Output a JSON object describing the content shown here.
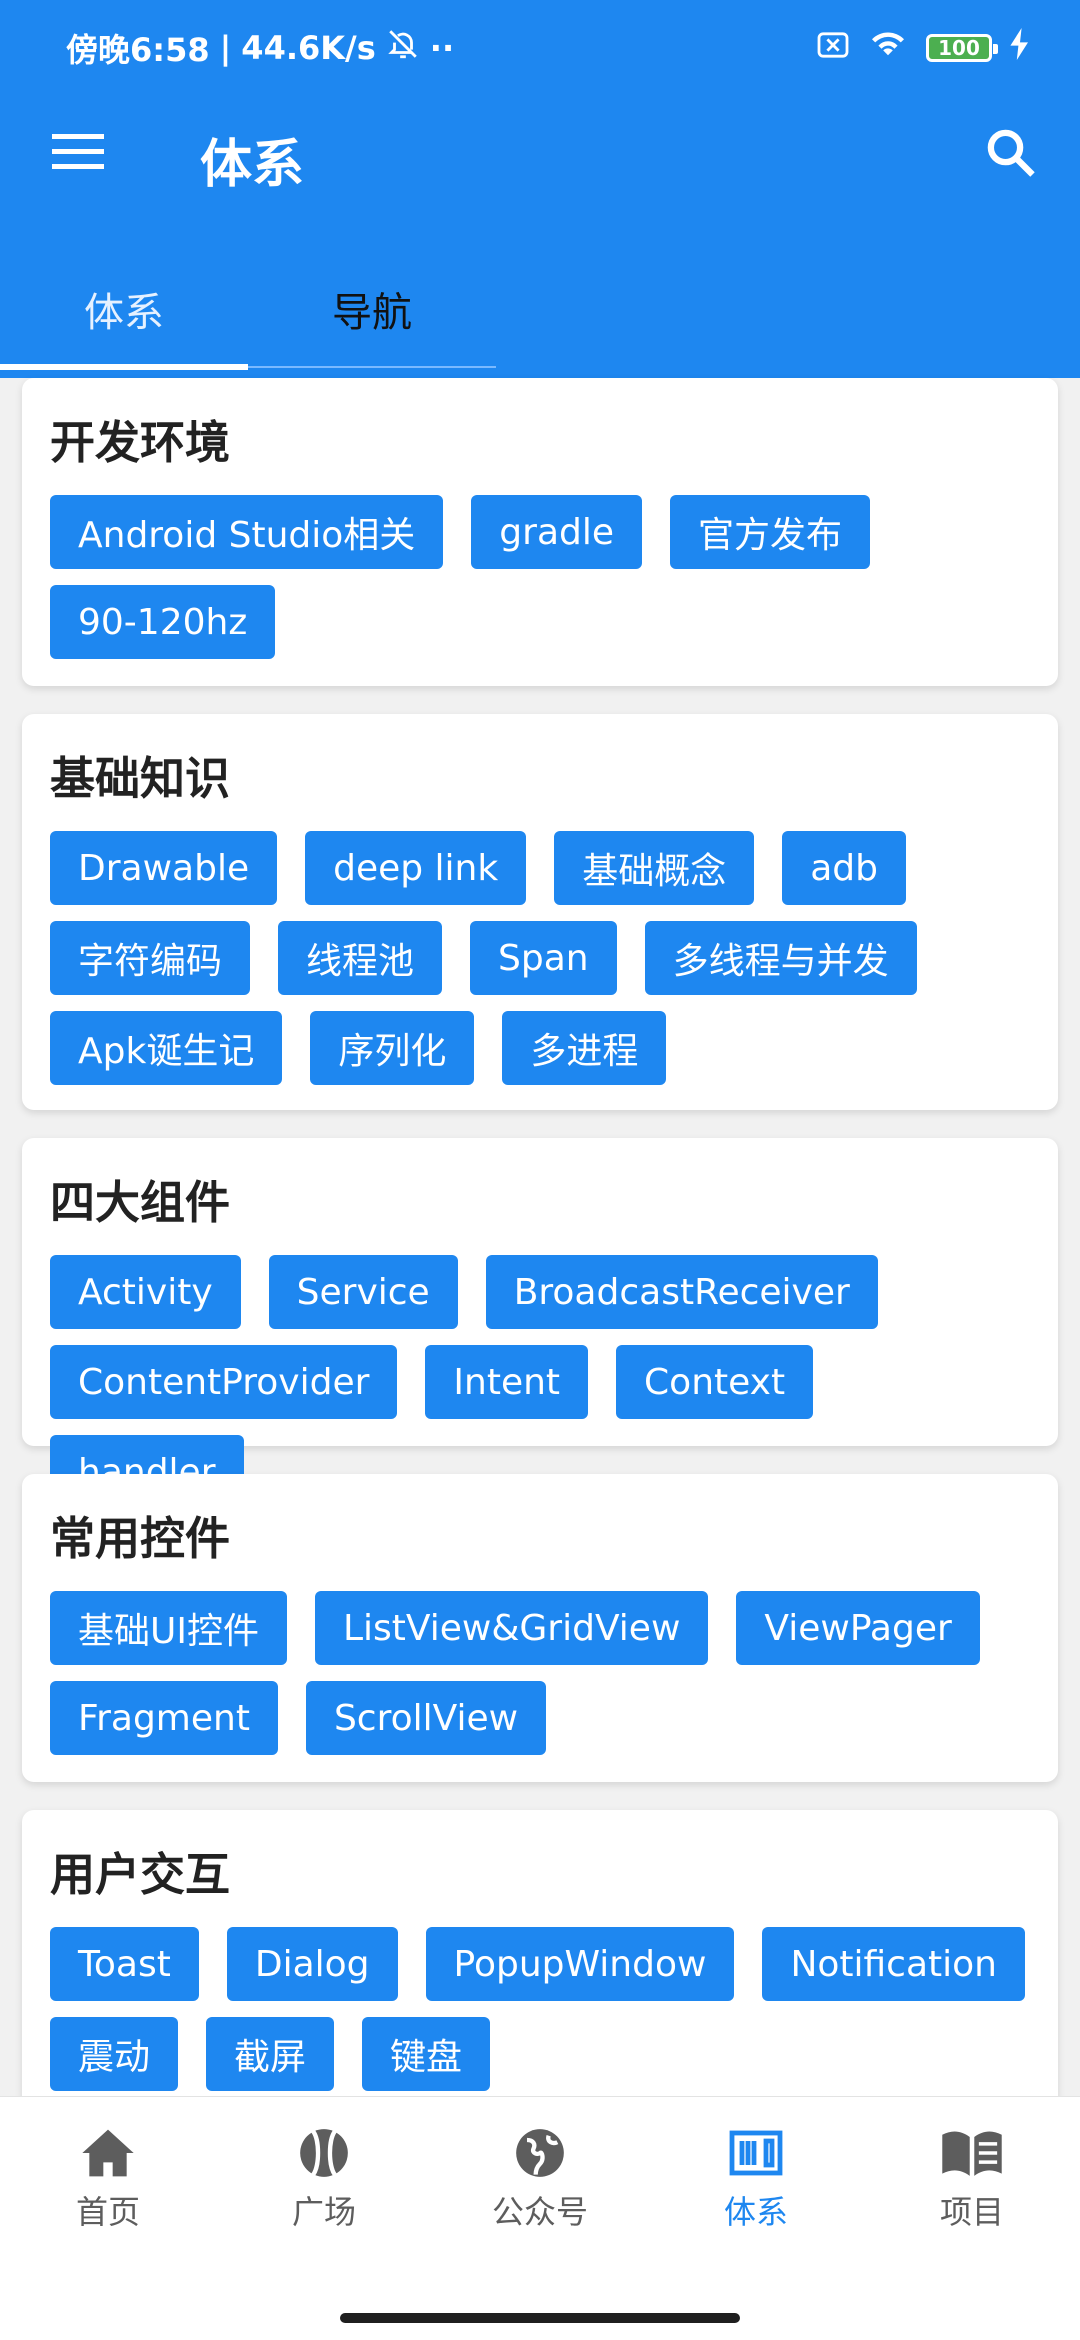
{
  "status_bar": {
    "time_text": "傍晚6:58",
    "speed_text": "44.6K/s",
    "battery_text": "100"
  },
  "toolbar": {
    "title": "体系"
  },
  "tabs": [
    {
      "label": "体系"
    },
    {
      "label": "导航"
    }
  ],
  "cards": [
    {
      "title": "开发环境",
      "tags": [
        "Android Studio相关",
        "gradle",
        "官方发布",
        "90-120hz"
      ]
    },
    {
      "title": "基础知识",
      "tags": [
        "Drawable",
        "deep link",
        "基础概念",
        "adb",
        "字符编码",
        "线程池",
        "Span",
        "多线程与并发",
        "Apk诞生记",
        "序列化",
        "多进程"
      ]
    },
    {
      "title": "四大组件",
      "tags": [
        "Activity",
        "Service",
        "BroadcastReceiver",
        "ContentProvider",
        "Intent",
        "Context",
        "handler"
      ]
    },
    {
      "title": "常用控件",
      "tags": [
        "基础UI控件",
        "ListView&GridView",
        "ViewPager",
        "Fragment",
        "ScrollView"
      ]
    },
    {
      "title": "用户交互",
      "tags": [
        "Toast",
        "Dialog",
        "PopupWindow",
        "Notification",
        "震动",
        "截屏",
        "键盘"
      ]
    }
  ],
  "bottom_nav": [
    {
      "label": "首页",
      "icon": "home-icon"
    },
    {
      "label": "广场",
      "icon": "ball-icon"
    },
    {
      "label": "公众号",
      "icon": "globe-icon"
    },
    {
      "label": "体系",
      "icon": "system-icon",
      "active": true
    },
    {
      "label": "项目",
      "icon": "book-icon"
    }
  ],
  "colors": {
    "primary": "#1e87f0",
    "background": "#f1f1f1",
    "text": "#222222",
    "nav_inactive": "#5d5d5d"
  }
}
